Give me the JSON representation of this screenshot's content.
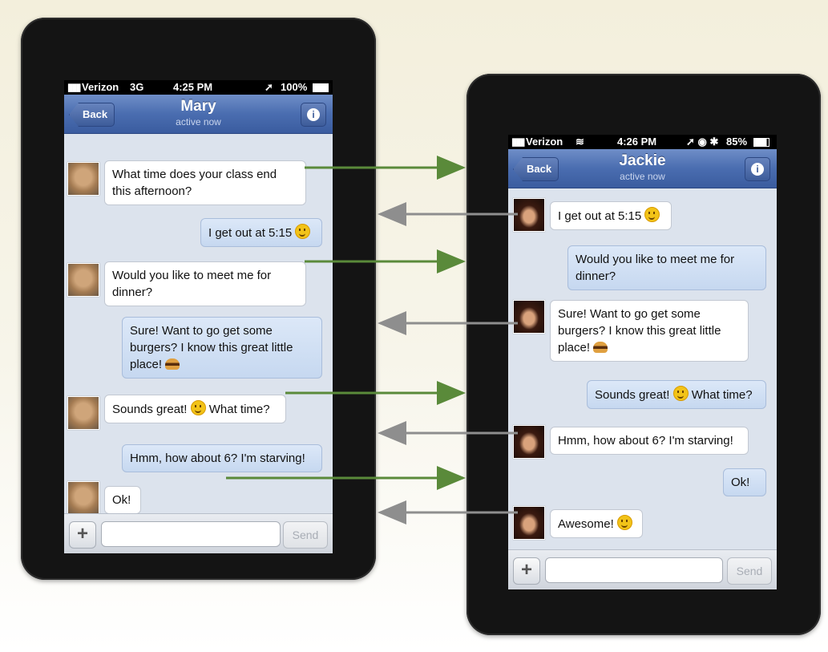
{
  "colors": {
    "to_jackie": "#5a8a3a",
    "to_mary": "#8e8e8e",
    "nav_bar": "#4a6db0"
  },
  "phone_left": {
    "status": {
      "carrier": "Verizon",
      "network": "3G",
      "time": "4:25 PM",
      "battery": "100%"
    },
    "nav": {
      "back": "Back",
      "title": "Mary",
      "subtitle": "active now"
    },
    "messages": [
      {
        "dir": "in",
        "text": "What time does your class end this afternoon?"
      },
      {
        "dir": "out",
        "text": "I get out at 5:15"
      },
      {
        "dir": "in",
        "text": "Would you like to meet me for dinner?"
      },
      {
        "dir": "out",
        "text": "Sure! Want to go get some burgers? I know this great little place!"
      },
      {
        "dir": "in",
        "text": "Sounds great!",
        "text2": "What time?"
      },
      {
        "dir": "out",
        "text": "Hmm, how about 6? I'm starving!"
      },
      {
        "dir": "in",
        "text": "Ok!"
      }
    ],
    "input": {
      "placeholder": "",
      "send": "Send"
    }
  },
  "phone_right": {
    "status": {
      "carrier": "Verizon",
      "time": "4:26 PM",
      "battery": "85%"
    },
    "nav": {
      "back": "Back",
      "title": "Jackie",
      "subtitle": "active now"
    },
    "messages": [
      {
        "dir": "in",
        "text": "I get out at 5:15"
      },
      {
        "dir": "out",
        "text": "Would you like to meet me for dinner?"
      },
      {
        "dir": "in",
        "text": "Sure! Want to go get some burgers? I know this great little place!"
      },
      {
        "dir": "out",
        "text": "Sounds great!",
        "text2": "What time?"
      },
      {
        "dir": "in",
        "text": "Hmm, how about 6? I'm starving!"
      },
      {
        "dir": "out",
        "text": "Ok!"
      },
      {
        "dir": "in",
        "text": "Awesome!"
      }
    ],
    "input": {
      "placeholder": "",
      "send": "Send"
    }
  }
}
